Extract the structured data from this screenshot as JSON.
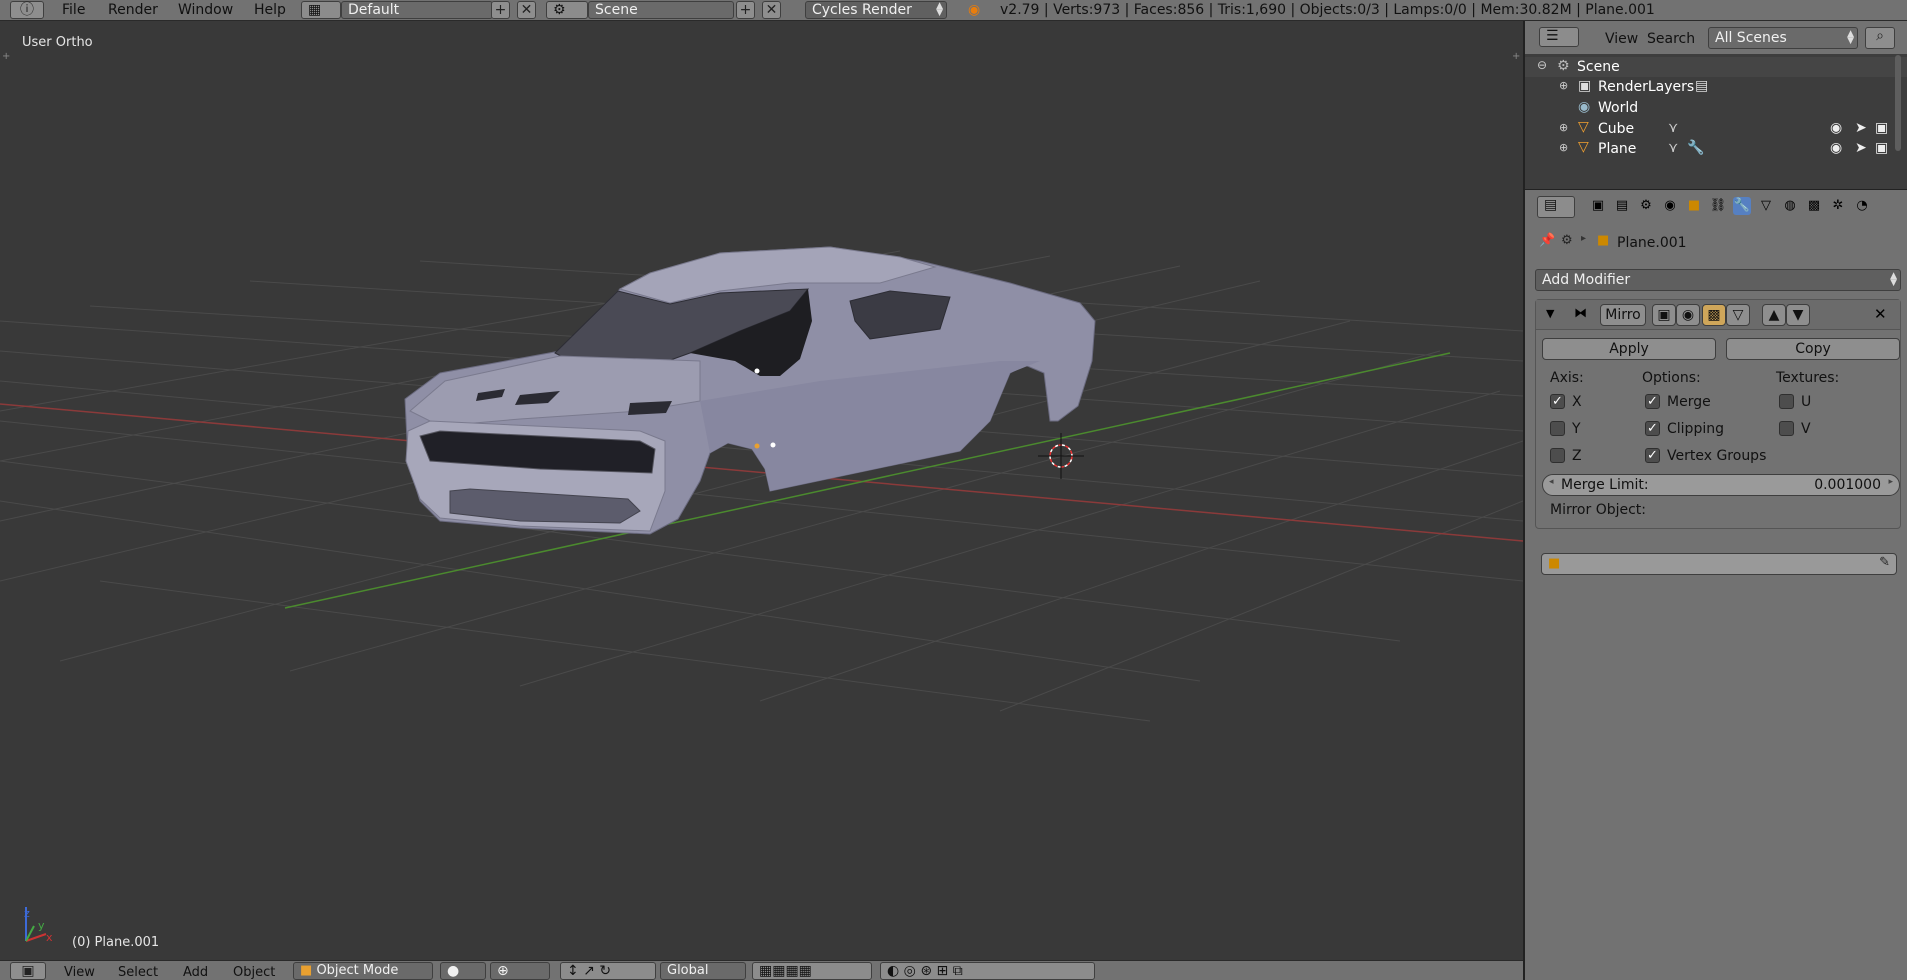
{
  "topbar": {
    "menus": [
      "File",
      "Render",
      "Window",
      "Help"
    ],
    "layout_name": "Default",
    "scene_name": "Scene",
    "render_engine": "Cycles Render",
    "stats": "v2.79 | Verts:973 | Faces:856 | Tris:1,690 | Objects:0/3 | Lamps:0/0 | Mem:30.82M | Plane.001"
  },
  "viewport": {
    "view_label": "User Ortho",
    "object_label": "(0) Plane.001",
    "axis_x": "x",
    "axis_y": "y",
    "axis_z": "z"
  },
  "bottombar": {
    "menus": [
      "View",
      "Select",
      "Add",
      "Object"
    ],
    "mode": "Object Mode",
    "orientation": "Global"
  },
  "outliner": {
    "menus": [
      "View",
      "Search"
    ],
    "filter": "All Scenes",
    "rows": [
      {
        "label": "Scene"
      },
      {
        "label": "RenderLayers"
      },
      {
        "label": "World"
      },
      {
        "label": "Cube"
      },
      {
        "label": "Plane"
      }
    ]
  },
  "properties": {
    "context_object": "Plane.001",
    "add_modifier": "Add Modifier",
    "modifier_name": "Mirro",
    "apply_label": "Apply",
    "copy_label": "Copy",
    "axis_title": "Axis:",
    "options_title": "Options:",
    "textures_title": "Textures:",
    "axis": [
      {
        "label": "X",
        "checked": true
      },
      {
        "label": "Y",
        "checked": false
      },
      {
        "label": "Z",
        "checked": false
      }
    ],
    "options": [
      {
        "label": "Merge",
        "checked": true
      },
      {
        "label": "Clipping",
        "checked": true
      },
      {
        "label": "Vertex Groups",
        "checked": true
      }
    ],
    "textures": [
      {
        "label": "U",
        "checked": false
      },
      {
        "label": "V",
        "checked": false
      }
    ],
    "merge_limit_label": "Merge Limit:",
    "merge_limit_value": "0.001000",
    "mirror_object_label": "Mirror Object:"
  }
}
